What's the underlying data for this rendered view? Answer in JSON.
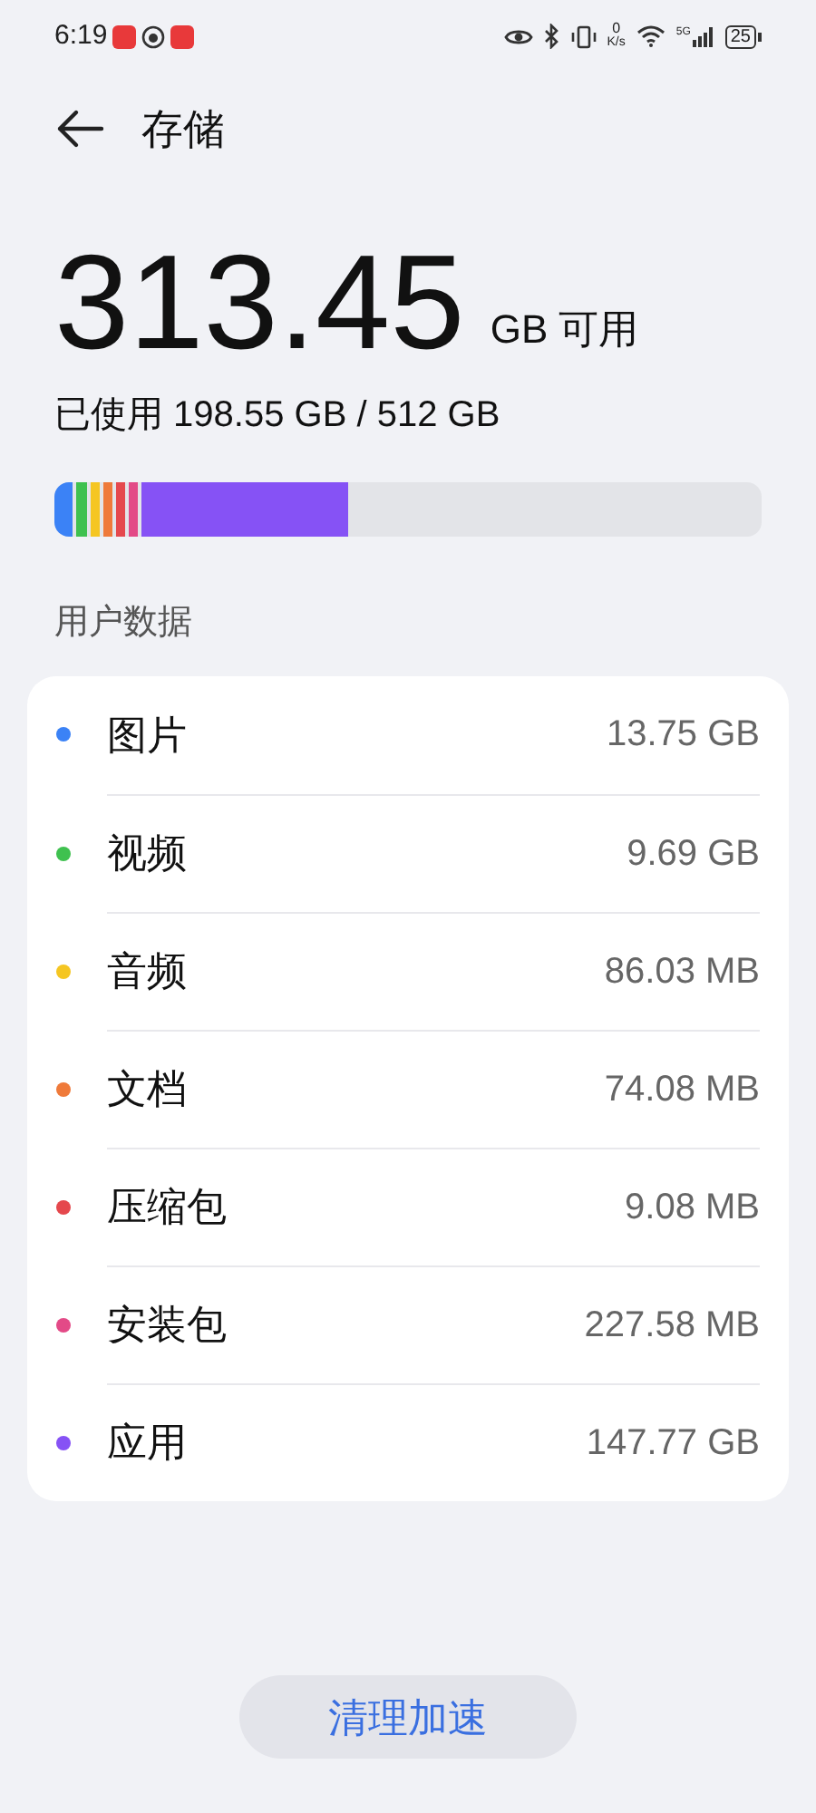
{
  "status_bar": {
    "time": "6:19",
    "speed_value": "0",
    "speed_unit": "K/s",
    "network": "5G",
    "battery": "25"
  },
  "header": {
    "title": "存储"
  },
  "summary": {
    "available": "313.45",
    "unit": "GB 可用",
    "used": "已使用 198.55 GB / 512 GB"
  },
  "section_title": "用户数据",
  "categories": [
    {
      "name": "图片",
      "size": "13.75 GB",
      "color": "#3b82f6",
      "level": 0.026
    },
    {
      "name": "视频",
      "size": "9.69 GB",
      "color": "#3fc14f",
      "level": 0.016
    },
    {
      "name": "音频",
      "size": "86.03 MB",
      "color": "#f5c622",
      "level": 0.013
    },
    {
      "name": "文档",
      "size": "74.08 MB",
      "color": "#ef7a3a"
    },
    {
      "name": "压缩包",
      "size": "9.08 MB",
      "color": "#e5484d"
    },
    {
      "name": "安装包",
      "size": "227.58 MB",
      "color": "#e34a87"
    },
    {
      "name": "应用",
      "size": "147.77 GB",
      "color": "#8652f5",
      "level": 0.29
    }
  ],
  "action_button": "清理加速"
}
